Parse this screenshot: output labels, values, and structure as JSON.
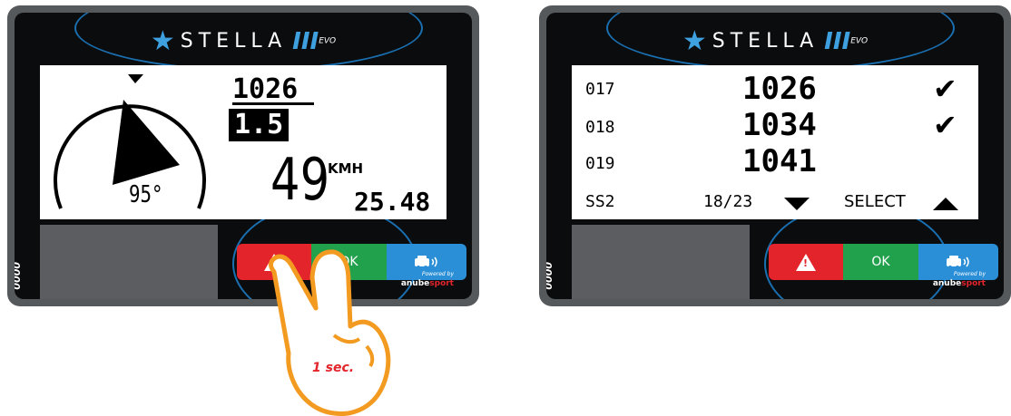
{
  "brand": {
    "name": "STELLA",
    "model": "III",
    "edition": "EVO",
    "powered_by": "Powered by",
    "maker_a": "anube",
    "maker_b": "sport"
  },
  "serial": "0000",
  "buttons": {
    "alert": "!",
    "ok": "OK",
    "car": "car-signal-icon"
  },
  "left_screen": {
    "heading_deg": "95°",
    "reference": "1026",
    "distance": "1.5",
    "speed": "49",
    "speed_unit": "KMH",
    "average": "25.48"
  },
  "right_screen": {
    "rows": [
      {
        "id": "017",
        "value": "1026",
        "checked": true
      },
      {
        "id": "018",
        "value": "1034",
        "checked": true
      },
      {
        "id": "019",
        "value": "1041",
        "checked": false
      }
    ],
    "stage": "SS2",
    "page": "18/23",
    "select_label": "SELECT"
  },
  "gesture": {
    "hold_time": "1 sec."
  },
  "colors": {
    "red": "#e3242b",
    "green": "#21a14b",
    "blue": "#2a8fd6",
    "hand": "#f39a21"
  }
}
